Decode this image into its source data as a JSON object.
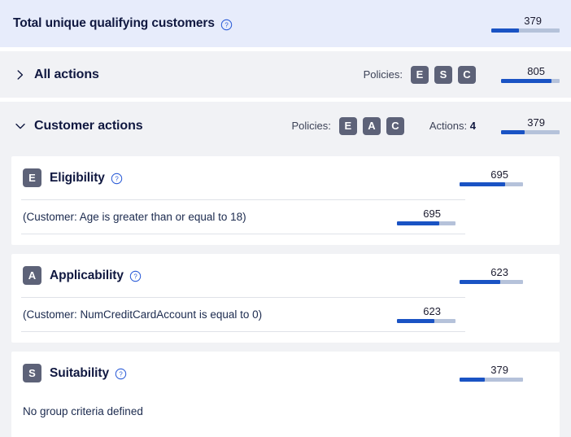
{
  "colors": {
    "header_bg": "#e7ecfb",
    "row_bg": "#f1f2f5",
    "badge_bg": "#5d6278",
    "bar_fill": "#1a53c4",
    "bar_track": "#b5c2da",
    "title_text": "#101840",
    "help_icon": "#2a5bd7"
  },
  "header": {
    "title": "Total unique qualifying customers",
    "help_icon": "help-circle-icon",
    "bar": {
      "value": "379",
      "percent": 40
    }
  },
  "rows": [
    {
      "id": "all-actions",
      "chevron": "chevron-right-icon",
      "expanded": false,
      "title": "All actions",
      "policies_label": "Policies:",
      "policies": [
        "E",
        "S",
        "C"
      ],
      "actions_label": "",
      "actions_value": "",
      "bar": {
        "value": "805",
        "percent": 86
      }
    },
    {
      "id": "customer-actions",
      "chevron": "chevron-down-icon",
      "expanded": true,
      "title": "Customer actions",
      "policies_label": "Policies:",
      "policies": [
        "E",
        "A",
        "C"
      ],
      "actions_label": "Actions:",
      "actions_value": "4",
      "bar": {
        "value": "379",
        "percent": 40
      }
    }
  ],
  "cards": [
    {
      "id": "eligibility",
      "badge": "E",
      "title": "Eligibility",
      "help_icon": "help-circle-icon",
      "bar": {
        "value": "695",
        "percent": 72
      },
      "has_criteria": true,
      "criteria": [
        {
          "text": "(Customer: Age is greater than or equal to 18)",
          "bar": {
            "value": "695",
            "percent": 72
          }
        }
      ],
      "empty_text": ""
    },
    {
      "id": "applicability",
      "badge": "A",
      "title": "Applicability",
      "help_icon": "help-circle-icon",
      "bar": {
        "value": "623",
        "percent": 64
      },
      "has_criteria": true,
      "criteria": [
        {
          "text": "(Customer: NumCreditCardAccount is equal to 0)",
          "bar": {
            "value": "623",
            "percent": 64
          }
        }
      ],
      "empty_text": ""
    },
    {
      "id": "suitability",
      "badge": "S",
      "title": "Suitability",
      "help_icon": "help-circle-icon",
      "bar": {
        "value": "379",
        "percent": 40
      },
      "has_criteria": false,
      "criteria": [],
      "empty_text": "No group criteria defined"
    }
  ]
}
